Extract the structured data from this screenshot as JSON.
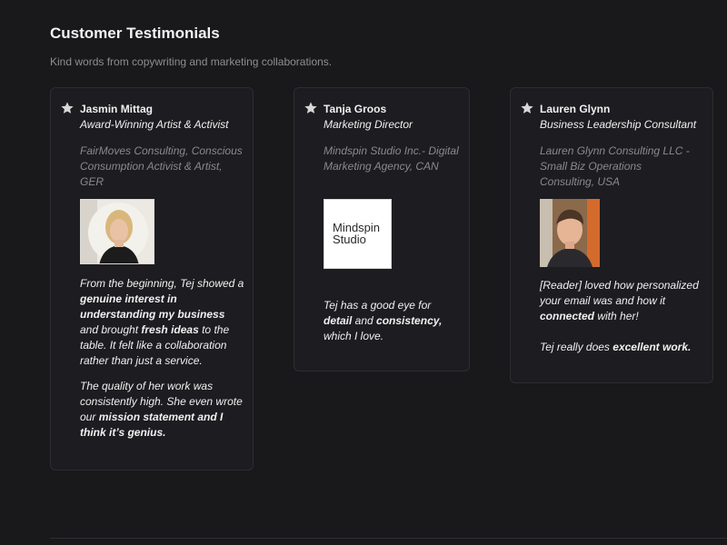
{
  "page": {
    "title": "Customer Testimonials",
    "subtitle": "Kind words from copywriting and marketing collaborations."
  },
  "testimonials": [
    {
      "name": "Jasmin Mittag",
      "role": "Award-Winning Artist & Activist",
      "org": "FairMoves Consulting, Conscious Consumption Activist & Artist, GER",
      "p1": [
        "From the beginning, Tej showed a ",
        "genuine interest in understanding my business",
        " and brought ",
        "fresh ideas",
        " to the table. It felt like a collaboration rather than just a service."
      ],
      "p2": [
        "The quality of her work was consistently high. She even wrote our ",
        "mission statement and I think it’s genius."
      ]
    },
    {
      "name": "Tanja Groos",
      "role": "Marketing Director",
      "org": "Mindspin Studio Inc.- Digital Marketing Agency, CAN",
      "logo_text_1": "Mindspin",
      "logo_text_2": "Studio",
      "p1": [
        "Tej has a good eye for ",
        "detail",
        " and ",
        "consistency,",
        " which I love."
      ]
    },
    {
      "name": "Lauren Glynn",
      "role": "Business Leadership Consultant",
      "org": "Lauren Glynn Consulting LLC - Small Biz Operations Consulting, USA",
      "p1": [
        "[Reader] loved how personalized your email was and how it ",
        "connected",
        " with her!"
      ],
      "p2": [
        "Tej really does ",
        "excellent work."
      ]
    }
  ]
}
